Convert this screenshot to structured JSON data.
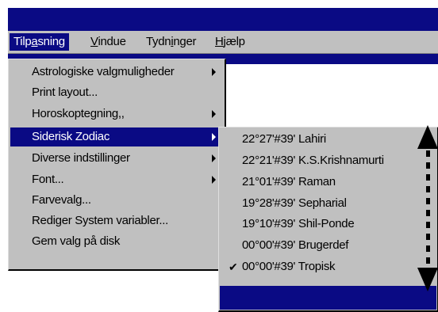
{
  "menubar": {
    "items": [
      {
        "pre": "Tilp",
        "u": "a",
        "post": "sning"
      },
      {
        "pre": "",
        "u": "V",
        "post": "indue"
      },
      {
        "pre": "Tydn",
        "u": "i",
        "post": "nger"
      },
      {
        "pre": "",
        "u": "H",
        "post": "jælp"
      }
    ]
  },
  "menu": {
    "items": [
      {
        "label": "Astrologiske valgmuligheder",
        "submenu": true
      },
      {
        "label": "Print layout...",
        "submenu": false
      },
      {
        "label": "Horoskoptegning,,",
        "submenu": true
      },
      {
        "label": "Siderisk Zodiac",
        "submenu": true,
        "highlighted": true
      },
      {
        "label": "Diverse indstillinger",
        "submenu": true
      },
      {
        "label": "Font...",
        "submenu": true
      },
      {
        "label": "Farvevalg...",
        "submenu": false
      },
      {
        "label": "Rediger System variabler...",
        "submenu": false
      },
      {
        "label": "Gem valg på disk",
        "submenu": false
      }
    ]
  },
  "submenu": {
    "items": [
      {
        "label": "22°27'#39' Lahiri",
        "checked": false
      },
      {
        "label": "22°21'#39' K.S.Krishnamurti",
        "checked": false
      },
      {
        "label": "21°01'#39' Raman",
        "checked": false
      },
      {
        "label": "19°28'#39' Sepharial",
        "checked": false
      },
      {
        "label": "19°10'#39' Shil-Ponde",
        "checked": false
      },
      {
        "label": "00°00'#39' Brugerdef",
        "checked": false
      },
      {
        "label": "00°00'#39' Tropisk",
        "checked": true
      }
    ]
  },
  "icons": {
    "check": "checkmark-icon",
    "submenu_arrow": "chevron-right-icon",
    "scroll": "scroll-arrows"
  },
  "colors": {
    "highlight": "#0a0a84",
    "menu_bg": "#c0c0c0"
  }
}
